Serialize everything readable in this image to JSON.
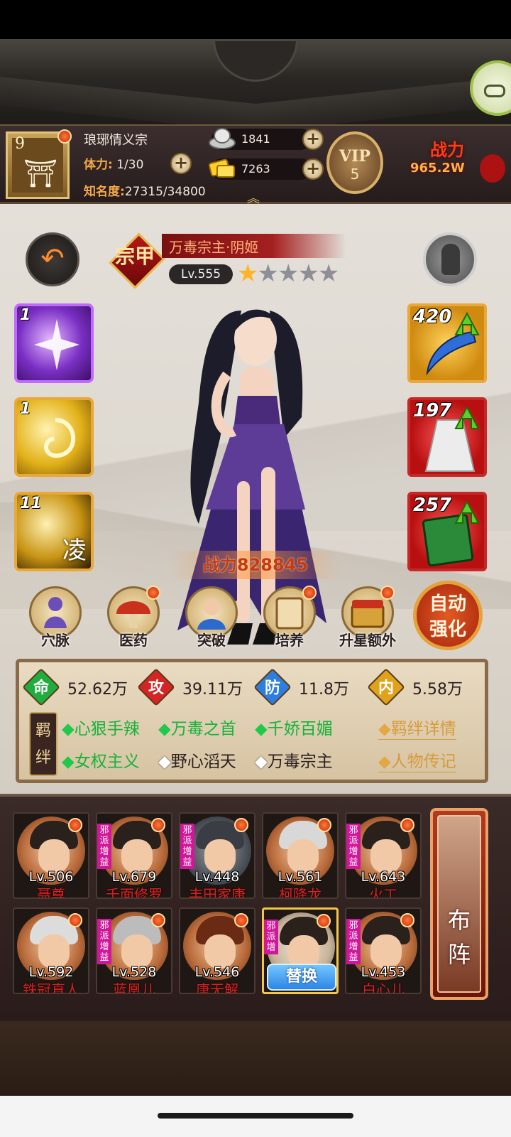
{
  "header": {
    "level": "9",
    "sect_name": "琅琊情义宗",
    "stamina_label": "体力:",
    "stamina_value": "1/30",
    "fame_label": "知名度:",
    "fame_value": "27315/34800",
    "silver": "1841",
    "gold": "7263",
    "vip_label": "VIP",
    "vip_level": "5",
    "power_label": "战力",
    "power_value": "965.2W"
  },
  "hero": {
    "title": "万毒宗主·阴姬",
    "level": "Lv.555",
    "badge": "宗甲",
    "stars_on": "★",
    "stars_off": "★★★★",
    "power": "战力828845"
  },
  "skills": [
    {
      "level": "1",
      "glyph": ""
    },
    {
      "level": "1",
      "glyph": ""
    },
    {
      "level": "11",
      "glyph": "凌"
    }
  ],
  "equipment": [
    {
      "level": "420"
    },
    {
      "level": "197"
    },
    {
      "level": "257"
    }
  ],
  "functions": [
    "穴脉",
    "医药",
    "突破",
    "培养",
    "升星额外"
  ],
  "auto_button": "自动强化",
  "stats": [
    {
      "key": "命",
      "value": "52.62万",
      "color": "#1fae3d"
    },
    {
      "key": "攻",
      "value": "39.11万",
      "color": "#d62323"
    },
    {
      "key": "防",
      "value": "11.8万",
      "color": "#2c7ee0"
    },
    {
      "key": "内",
      "value": "5.58万",
      "color": "#e0a21a"
    }
  ],
  "bonds_label": "羁绊",
  "bonds_row1": [
    "心狠手辣",
    "万毒之首",
    "千娇百媚"
  ],
  "bonds_row2_active": [
    "女权主义"
  ],
  "bonds_row2_inactive": [
    "野心滔天",
    "万毒宗主"
  ],
  "links": [
    "羁绊详情",
    "人物传记"
  ],
  "roster": [
    {
      "level": "Lv.506",
      "name": "聂尊",
      "evil": ""
    },
    {
      "level": "Lv.679",
      "name": "千面修罗",
      "evil": "邪派增益"
    },
    {
      "level": "Lv.448",
      "name": "丰田家康",
      "evil": "邪派增益"
    },
    {
      "level": "Lv.561",
      "name": "柯降龙",
      "evil": ""
    },
    {
      "level": "Lv.643",
      "name": "火工",
      "evil": "邪派增益"
    },
    {
      "level": "Lv.592",
      "name": "铁冠真人",
      "evil": ""
    },
    {
      "level": "Lv.528",
      "name": "蓝凰儿",
      "evil": "邪派增益"
    },
    {
      "level": "Lv.546",
      "name": "唐无解",
      "evil": ""
    },
    {
      "level": "",
      "name": "",
      "evil": "邪派增"
    },
    {
      "level": "Lv.453",
      "name": "白心儿",
      "evil": "邪派增益"
    }
  ],
  "swap_button": "替换",
  "formation_button": "布阵",
  "colors": {
    "accent_red": "#c63a12",
    "gold": "#e8a83a",
    "bond_green": "#15b33b"
  }
}
